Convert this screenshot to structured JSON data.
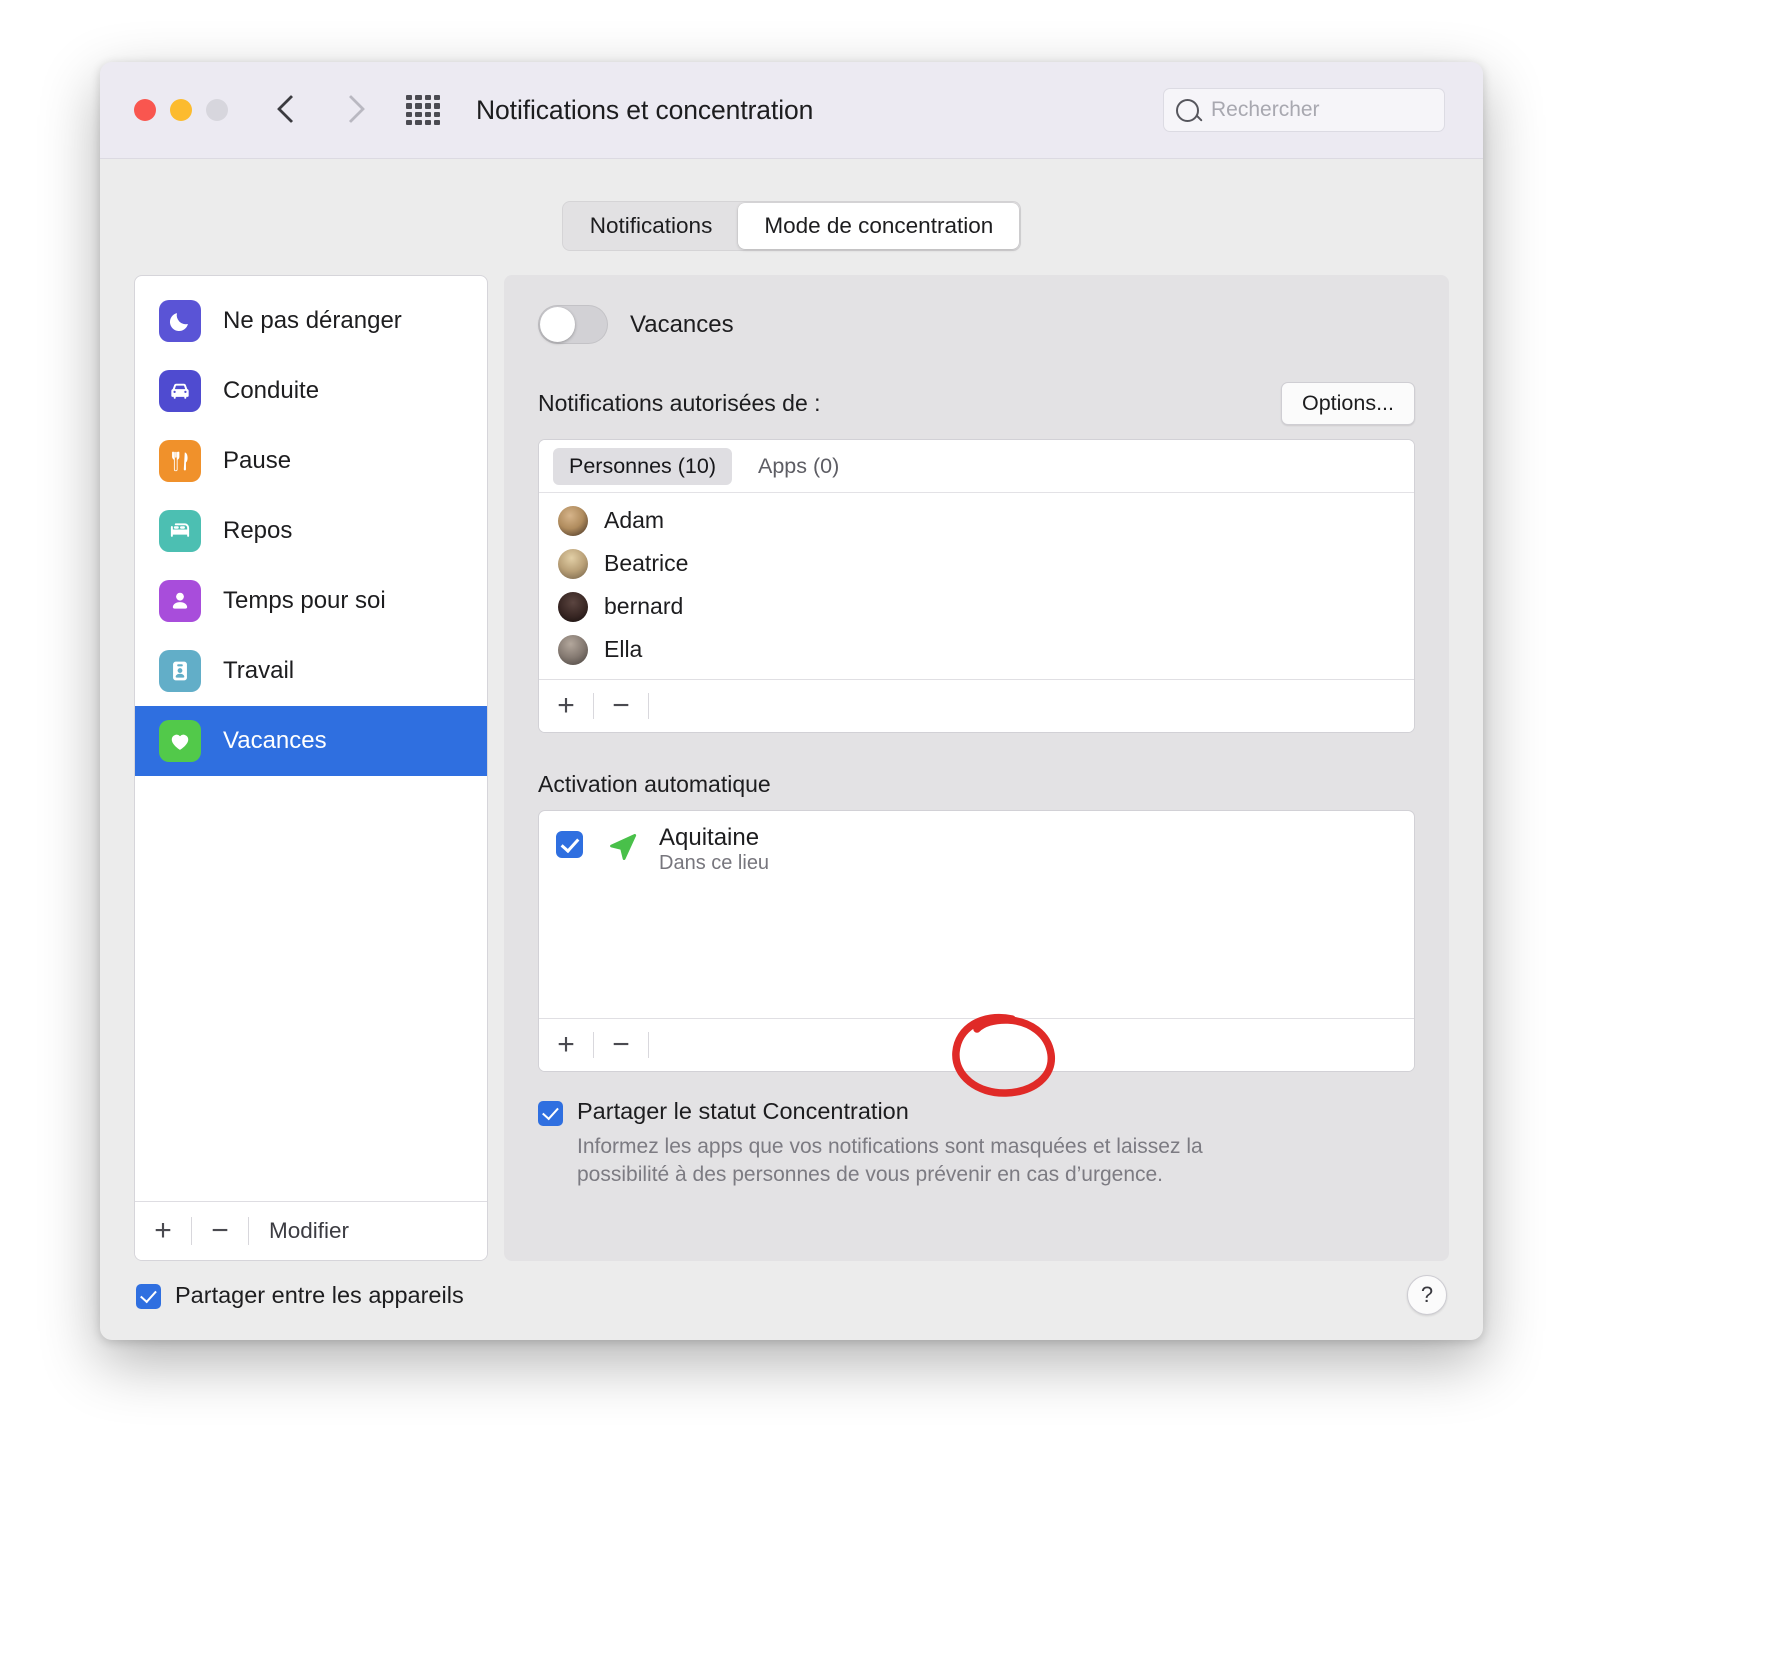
{
  "window": {
    "title": "Notifications et concentration",
    "traffic_lights": [
      "close",
      "minimize",
      "zoom"
    ],
    "nav": {
      "back": "back-chevron",
      "forward": "forward-chevron"
    },
    "grid_icon": "all-preferences-grid-icon",
    "search": {
      "placeholder": "Rechercher",
      "value": ""
    }
  },
  "tabs": [
    {
      "label": "Notifications",
      "active": false
    },
    {
      "label": "Mode de concentration",
      "active": true
    }
  ],
  "sidebar": {
    "modes": [
      {
        "label": "Ne pas déranger",
        "icon": "moon-icon",
        "color": "#5a54d6",
        "selected": false
      },
      {
        "label": "Conduite",
        "icon": "car-icon",
        "color": "#4f4bd0",
        "selected": false
      },
      {
        "label": "Pause",
        "icon": "fork-knife-icon",
        "color": "#f0912b",
        "selected": false
      },
      {
        "label": "Repos",
        "icon": "bed-icon",
        "color": "#4cbfb2",
        "selected": false
      },
      {
        "label": "Temps pour soi",
        "icon": "person-icon",
        "color": "#a84ddb",
        "selected": false
      },
      {
        "label": "Travail",
        "icon": "badge-icon",
        "color": "#62aec8",
        "selected": false
      },
      {
        "label": "Vacances",
        "icon": "heart-icon",
        "color": "#52c94a",
        "selected": true
      }
    ],
    "footer": {
      "add": "+",
      "remove": "−",
      "modify": "Modifier"
    },
    "selection_color": "#2f6fe0"
  },
  "detail": {
    "toggle": {
      "label": "Vacances",
      "on": false
    },
    "allowed_section": {
      "title": "Notifications autorisées de :",
      "options_button": "Options...",
      "segments": [
        {
          "label": "Personnes (10)",
          "active": true
        },
        {
          "label": "Apps (0)",
          "active": false
        }
      ],
      "people": [
        {
          "name": "Adam",
          "avatar_colors": [
            "#c8a67e",
            "#4b3a2c"
          ]
        },
        {
          "name": "Beatrice",
          "avatar_colors": [
            "#d8c49a",
            "#7a6a50"
          ]
        },
        {
          "name": "bernard",
          "avatar_colors": [
            "#4a3a36",
            "#1d1513"
          ]
        },
        {
          "name": "Ella",
          "avatar_colors": [
            "#9c8f86",
            "#55504c"
          ]
        }
      ],
      "footer": {
        "add": "+",
        "remove": "−"
      }
    },
    "auto_activation": {
      "title": "Activation automatique",
      "rows": [
        {
          "checked": true,
          "icon": "location-arrow-icon",
          "icon_color": "#49c04a",
          "name": "Aquitaine",
          "subtitle": "Dans ce lieu"
        }
      ],
      "footer": {
        "add": "+",
        "remove": "−"
      }
    },
    "share_status": {
      "checked": true,
      "label": "Partager le statut Concentration",
      "description": "Informez les apps que vos notifications sont masquées et laissez la possibilité à des personnes de vous prévenir en cas d’urgence."
    }
  },
  "bottom": {
    "share_across": {
      "checked": true,
      "label": "Partager entre les appareils"
    },
    "help_button": "?"
  },
  "annotation": {
    "shape": "hand-drawn-circle",
    "color": "#e02a27",
    "targets": "auto-activation-add-button"
  }
}
